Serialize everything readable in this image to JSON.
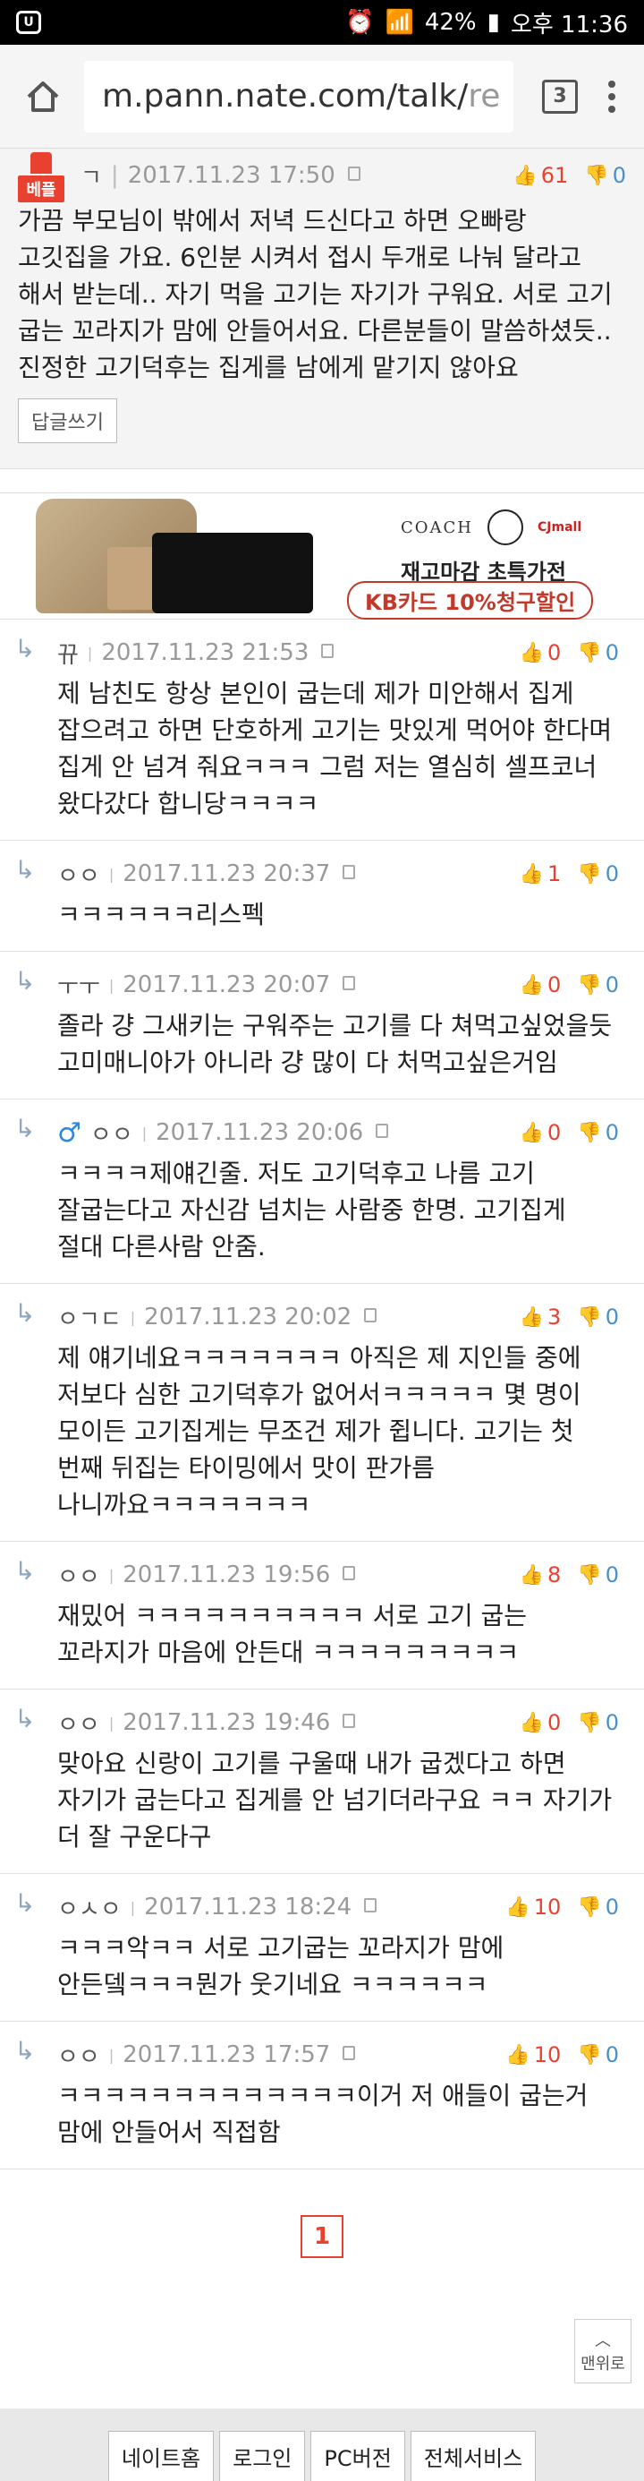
{
  "status_bar": {
    "battery": "42%",
    "time": "오후 11:36"
  },
  "browser": {
    "url_prefix": "m.pann.nate.com/talk/",
    "url_suffix": "re",
    "tab_count": "3"
  },
  "best_comment": {
    "badge": "베플",
    "nick": "ㄱ",
    "date": "2017.11.23 17:50",
    "up": "61",
    "down": "0",
    "text": "가끔 부모님이 밖에서 저녁 드신다고 하면 오빠랑 고깃집을 가요. 6인분 시켜서 접시 두개로 나눠 달라고 해서 받는데.. 자기 먹을 고기는 자기가 구워요. 서로 고기 굽는 꼬라지가 맘에 안들어서요. 다른분들이 말씀하셨듯.. 진정한 고기덕후는 집게를 남에게 맡기지 않아요",
    "reply_label": "답글쓰기"
  },
  "ad": {
    "brand1": "COACH",
    "brand3": "CJmall",
    "line1": "재고마감 초특가전",
    "line2": "KB카드 10%청구할인"
  },
  "comments": [
    {
      "nick": "뀨",
      "date": "2017.11.23 21:53",
      "up": "0",
      "down": "0",
      "text": "제 남친도 항상 본인이 굽는데 제가 미안해서 집게 잡으려고 하면 단호하게 고기는 맛있게 먹어야 한다며 집게 안 넘겨 줘요ㅋㅋㅋ 그럼 저는 열심히 셀프코너 왔다갔다 합니당ㅋㅋㅋㅋ"
    },
    {
      "nick": "ㅇㅇ",
      "date": "2017.11.23 20:37",
      "up": "1",
      "down": "0",
      "text": "ㅋㅋㅋㅋㅋㅋ리스펙"
    },
    {
      "nick": "ㅜㅜ",
      "date": "2017.11.23 20:07",
      "up": "0",
      "down": "0",
      "text": "졸라 걍 그새키는 구워주는 고기를 다 쳐먹고싶었을듯 고미매니아가 아니라 걍 많이 다 처먹고싶은거임"
    },
    {
      "nick": "ㅇㅇ",
      "date": "2017.11.23 20:06",
      "up": "0",
      "down": "0",
      "text": "ㅋㅋㅋㅋ제얘긴줄. 저도 고기덕후고 나름 고기 잘굽는다고 자신감 넘치는 사람중 한명. 고기집게 절대 다른사람 안줌."
    },
    {
      "nick": "ㅇㄱㄷ",
      "date": "2017.11.23 20:02",
      "up": "3",
      "down": "0",
      "text": "제 얘기네요ㅋㅋㅋㅋㅋㅋㅋ 아직은 제 지인들 중에 저보다 심한 고기덕후가 없어서ㅋㅋㅋㅋㅋ 몇 명이 모이든 고기집게는 무조건 제가 쥡니다. 고기는 첫 번째 뒤집는 타이밍에서 맛이 판가름 나니까요ㅋㅋㅋㅋㅋㅋㅋ"
    },
    {
      "nick": "ㅇㅇ",
      "date": "2017.11.23 19:56",
      "up": "8",
      "down": "0",
      "text": "재밌어 ㅋㅋㅋㅋㅋㅋㅋㅋㅋㅋ 서로 고기 굽는 꼬라지가 마음에 안든대 ㅋㅋㅋㅋㅋㅋㅋㅋㅋ"
    },
    {
      "nick": "ㅇㅇ",
      "date": "2017.11.23 19:46",
      "up": "0",
      "down": "0",
      "text": "맞아요 신랑이 고기를 구울때 내가 굽겠다고 하면 자기가 굽는다고 집게를 안 넘기더라구요 ㅋㅋ 자기가 더 잘 구운다구"
    },
    {
      "nick": "ㅇㅅㅇ",
      "date": "2017.11.23 18:24",
      "up": "10",
      "down": "0",
      "text": "ㅋㅋㅋ악ㅋㅋ 서로 고기굽는 꼬라지가 맘에 안든뎈ㅋㅋㅋ뭔가 웃기네요 ㅋㅋㅋㅋㅋㅋ"
    },
    {
      "nick": "ㅇㅇ",
      "date": "2017.11.23 17:57",
      "up": "10",
      "down": "0",
      "text": "ㅋㅋㅋㅋㅋㅋㅋㅋㅋㅋㅋㅋㅋ이거 저 애들이 굽는거 맘에 안들어서 직접함"
    }
  ],
  "pager": {
    "current": "1"
  },
  "to_top_label": "맨위로",
  "footer": {
    "items": [
      "네이트홈",
      "로그인",
      "PC버전",
      "전체서비스"
    ]
  }
}
